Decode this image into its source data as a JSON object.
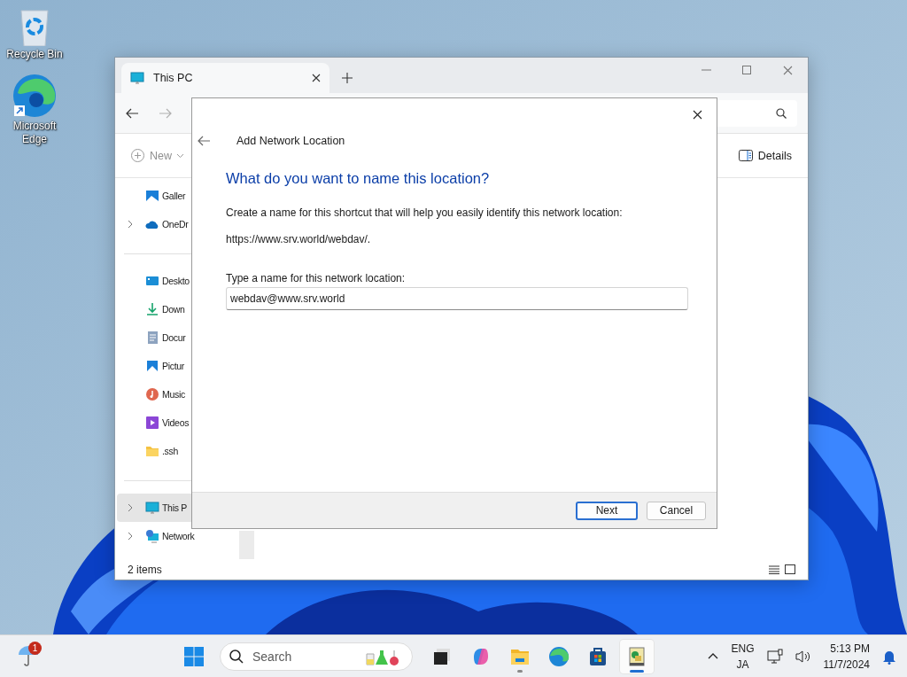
{
  "desktop_icons": [
    {
      "label": "Recycle Bin",
      "kind": "recycle"
    },
    {
      "label": "Microsoft Edge",
      "kind": "edge"
    }
  ],
  "explorer": {
    "tabs": [
      {
        "label": "This PC",
        "selected": true
      }
    ],
    "nav": [
      {
        "kind": "back",
        "disabled": false
      },
      {
        "kind": "forward",
        "disabled": true
      }
    ],
    "command_bar": {
      "new": "New",
      "details": "Details"
    },
    "sidebar": {
      "sections": [
        {
          "items": [
            {
              "label": "Galler",
              "kind": "gallery",
              "expandable": false,
              "selected": false
            },
            {
              "label": "OneDr",
              "kind": "cloud",
              "expandable": true,
              "selected": false
            }
          ]
        },
        {
          "items": [
            {
              "label": "Deskto",
              "kind": "desktop",
              "expandable": false,
              "selected": false
            },
            {
              "label": "Down",
              "kind": "download",
              "expandable": false,
              "selected": false
            },
            {
              "label": "Docur",
              "kind": "document",
              "expandable": false,
              "selected": false
            },
            {
              "label": "Pictur",
              "kind": "pictures",
              "expandable": false,
              "selected": false
            },
            {
              "label": "Music",
              "kind": "music",
              "expandable": false,
              "selected": false
            },
            {
              "label": "Videos",
              "kind": "videos",
              "expandable": false,
              "selected": false
            },
            {
              "label": ".ssh",
              "kind": "folder",
              "expandable": false,
              "selected": false
            }
          ]
        },
        {
          "items": [
            {
              "label": "This P",
              "kind": "pc",
              "expandable": true,
              "selected": true
            },
            {
              "label": "Network",
              "kind": "network",
              "expandable": true,
              "selected": false
            }
          ]
        }
      ]
    },
    "status_bar": "2 items"
  },
  "dialog": {
    "title": "Add Network Location",
    "heading": "What do you want to name this location?",
    "description": "Create a name for this shortcut that will help you easily identify this network location:",
    "address": "https://www.srv.world/webdav/.",
    "field_label": "Type a name for this network location:",
    "field_value": "webdav@www.srv.world",
    "buttons": [
      {
        "label": "Next",
        "default": true
      },
      {
        "label": "Cancel",
        "default": false
      }
    ]
  },
  "taskbar": {
    "weather_badge": "1",
    "search_placeholder": "Search",
    "apps": [
      {
        "kind": "taskview",
        "running": false,
        "selected": false
      },
      {
        "kind": "copilot",
        "running": false,
        "selected": false
      },
      {
        "kind": "files",
        "running": true,
        "selected": false
      },
      {
        "kind": "edge",
        "running": false,
        "selected": false
      },
      {
        "kind": "store",
        "running": false,
        "selected": false
      },
      {
        "kind": "app",
        "running": true,
        "selected": true
      }
    ],
    "language": "ENG",
    "input_method": "JA",
    "time": "5:13 PM",
    "date": "11/7/2024"
  }
}
